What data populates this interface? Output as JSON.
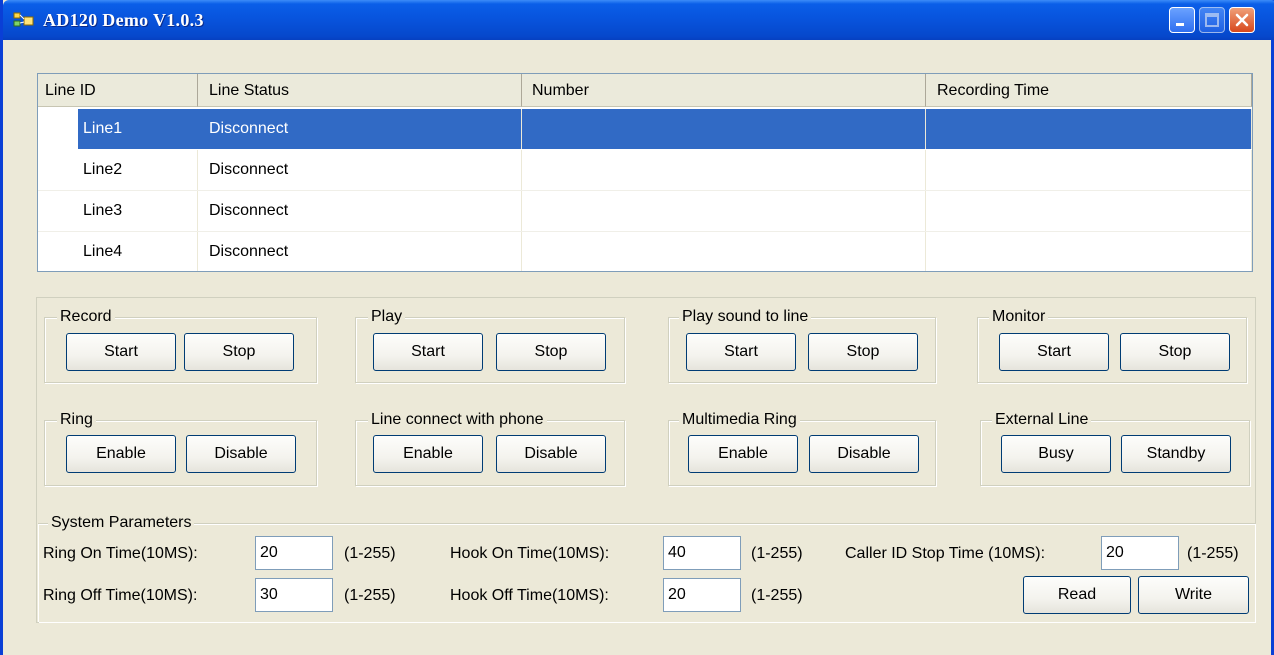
{
  "window": {
    "title": "AD120 Demo V1.0.3",
    "icons": {
      "app": "app-icon",
      "minimize": "minimize-icon",
      "maximize": "maximize-icon",
      "close": "close-icon"
    }
  },
  "list": {
    "columns": [
      "Line ID",
      "Line Status",
      "Number",
      "Recording Time"
    ],
    "rows": [
      {
        "line_id": "Line1",
        "status": "Disconnect",
        "number": "",
        "recording_time": "",
        "selected": true
      },
      {
        "line_id": "Line2",
        "status": "Disconnect",
        "number": "",
        "recording_time": ""
      },
      {
        "line_id": "Line3",
        "status": "Disconnect",
        "number": "",
        "recording_time": ""
      },
      {
        "line_id": "Line4",
        "status": "Disconnect",
        "number": "",
        "recording_time": ""
      }
    ]
  },
  "groups": {
    "record": {
      "label": "Record",
      "btn1": "Start",
      "btn2": "Stop"
    },
    "play": {
      "label": "Play",
      "btn1": "Start",
      "btn2": "Stop"
    },
    "play_sound": {
      "label": "Play sound to line",
      "btn1": "Start",
      "btn2": "Stop"
    },
    "monitor": {
      "label": "Monitor",
      "btn1": "Start",
      "btn2": "Stop"
    },
    "ring": {
      "label": "Ring",
      "btn1": "Enable",
      "btn2": "Disable"
    },
    "line_connect": {
      "label": "Line connect with phone",
      "btn1": "Enable",
      "btn2": "Disable"
    },
    "multimedia_ring": {
      "label": "Multimedia Ring",
      "btn1": "Enable",
      "btn2": "Disable"
    },
    "external_line": {
      "label": "External Line",
      "btn1": "Busy",
      "btn2": "Standby"
    }
  },
  "system": {
    "label": "System Parameters",
    "ring_on_label": "Ring On Time(10MS):",
    "ring_on_value": "20",
    "ring_off_label": "Ring Off Time(10MS):",
    "ring_off_value": "30",
    "hook_on_label": "Hook On Time(10MS):",
    "hook_on_value": "40",
    "hook_off_label": "Hook Off Time(10MS):",
    "hook_off_value": "20",
    "callerid_label": "Caller ID Stop Time (10MS):",
    "callerid_value": "20",
    "range": "(1-255)",
    "read_label": "Read",
    "write_label": "Write"
  },
  "colors": {
    "titlebar": "#0853dc",
    "selection": "#316ac5",
    "face": "#ece9d8"
  }
}
